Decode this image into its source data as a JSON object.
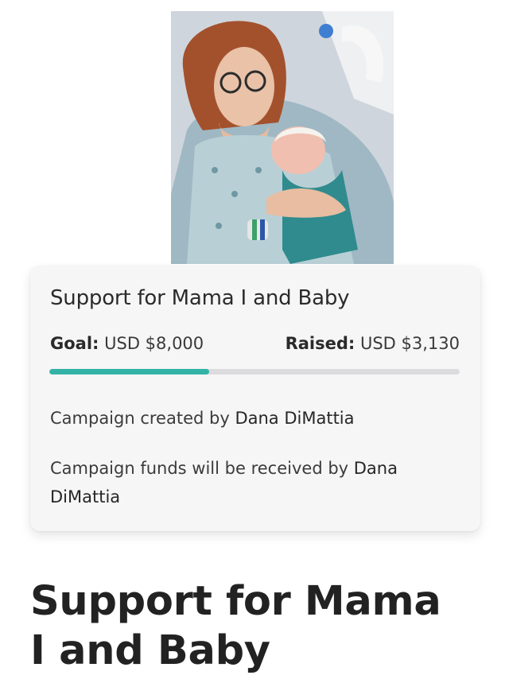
{
  "campaign": {
    "title": "Support for Mama I and Baby",
    "goal_label": "Goal:",
    "goal_value": "USD $8,000",
    "raised_label": "Raised:",
    "raised_value": "USD $3,130",
    "progress_fraction": 0.39,
    "created_prefix": "Campaign created by",
    "creator": "Dana DiMattia",
    "received_prefix": "Campaign funds will be received by",
    "recipient": "Dana DiMattia"
  },
  "page_title": "Support for Mama I and Baby",
  "colors": {
    "accent": "#33b3a6",
    "track": "#dcdcde",
    "card_bg": "#f6f6f7"
  }
}
